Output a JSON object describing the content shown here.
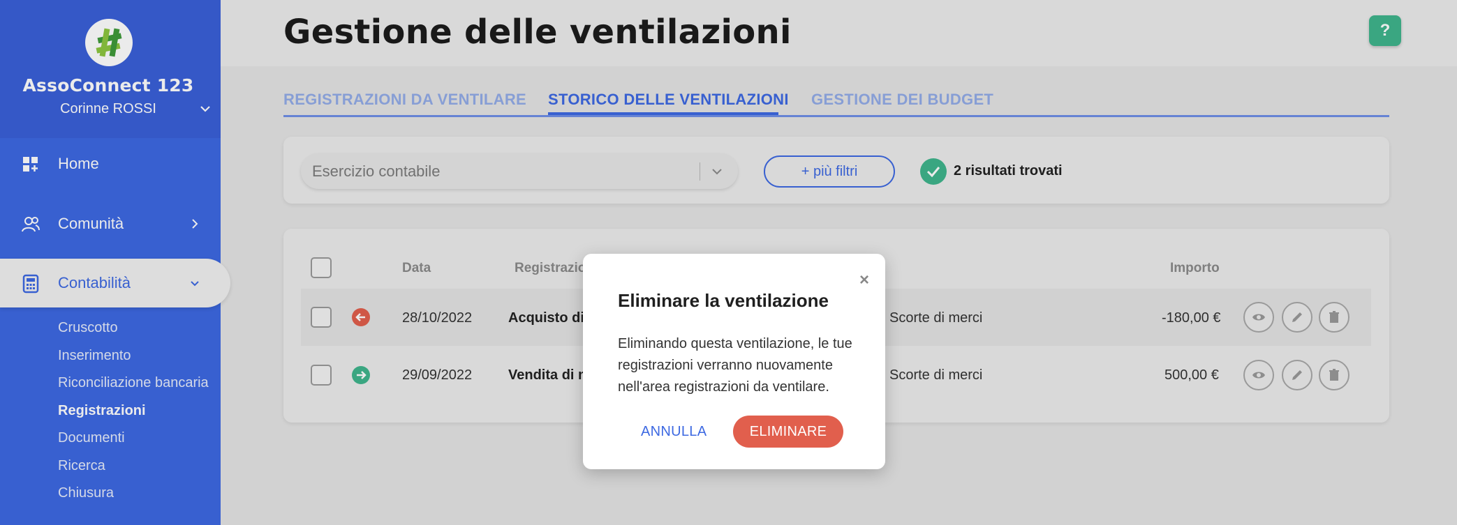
{
  "sidebar": {
    "org_name": "AssoConnect 123",
    "user_name": "Corinne ROSSI",
    "nav": [
      {
        "label": "Home",
        "icon": "dashboard-icon"
      },
      {
        "label": "Comunità",
        "icon": "users-icon"
      },
      {
        "label": "Contabilità",
        "icon": "calculator-icon"
      }
    ],
    "sub_items": [
      "Cruscotto",
      "Inserimento",
      "Riconciliazione bancaria",
      "Registrazioni",
      "Documenti",
      "Ricerca",
      "Chiusura"
    ],
    "active_sub": "Registrazioni"
  },
  "header": {
    "title": "Gestione delle ventilazioni",
    "help_label": "?"
  },
  "tabs": [
    {
      "label": "REGISTRAZIONI DA VENTILARE"
    },
    {
      "label": "STORICO DELLE VENTILAZIONI"
    },
    {
      "label": "GESTIONE DEI BUDGET"
    }
  ],
  "active_tab": "STORICO DELLE VENTILAZIONI",
  "filters": {
    "exercise_placeholder": "Esercizio contabile",
    "more_filters_label": "+ più filtri",
    "results_text": "2 risultati trovati"
  },
  "table": {
    "headers": {
      "date": "Data",
      "registration": "Registrazio",
      "amount": "Importo"
    },
    "rows": [
      {
        "direction": "out",
        "date": "28/10/2022",
        "registration": "Acquisto di",
        "account": "Scorte di merci",
        "amount": "-180,00 €"
      },
      {
        "direction": "in",
        "date": "29/09/2022",
        "registration": "Vendita di m",
        "account": "Scorte di merci",
        "amount": "500,00 €"
      }
    ]
  },
  "modal": {
    "close_label": "×",
    "title": "Eliminare la ventilazione",
    "body": "Eliminando questa ventilazione, le tue registrazioni verranno nuovamente nell'area registrazioni da ventilare.",
    "cancel_label": "ANNULLA",
    "delete_label": "ELIMINARE"
  },
  "colors": {
    "brand_blue": "#3d69e2",
    "success_green": "#3fb58d",
    "danger_red": "#e15f4d"
  }
}
